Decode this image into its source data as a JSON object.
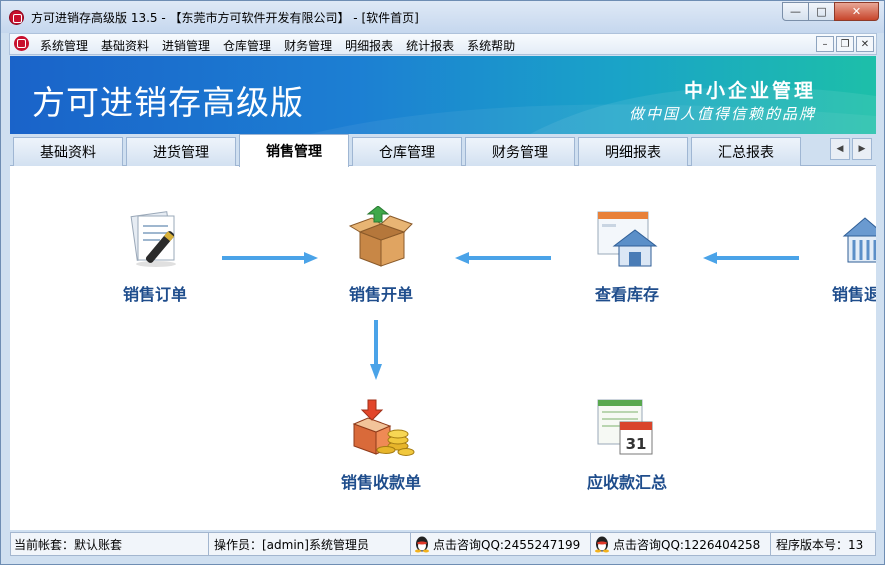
{
  "window": {
    "title": "方可进销存高级版 13.5 - 【东莞市方可软件开发有限公司】 - [软件首页]"
  },
  "menu": {
    "items": [
      "系统管理",
      "基础资料",
      "进销管理",
      "仓库管理",
      "财务管理",
      "明细报表",
      "统计报表",
      "系统帮助"
    ]
  },
  "banner": {
    "title": "方可进销存高级版",
    "slogan_line1": "中小企业管理",
    "slogan_line2": "做中国人值得信赖的品牌"
  },
  "tabs": {
    "items": [
      "基础资料",
      "进货管理",
      "销售管理",
      "仓库管理",
      "财务管理",
      "明细报表",
      "汇总报表"
    ],
    "active_index": 2
  },
  "flow": {
    "sales_order": "销售订单",
    "sales_invoice": "销售开单",
    "view_stock": "查看库存",
    "sales_return": "销售退",
    "sales_receipt": "销售收款单",
    "receivables_summary": "应收款汇总"
  },
  "status": {
    "account": "当前帐套：默认账套",
    "operator": "操作员：[admin]系统管理员",
    "qq1": "点击咨询QQ:2455247199",
    "qq2": "点击咨询QQ:1226404258",
    "version": "程序版本号：13"
  },
  "colors": {
    "accent_blue": "#1f4d8c",
    "arrow_blue": "#4aa3e8",
    "banner_start": "#1a63c9",
    "banner_end": "#1dbfa9"
  }
}
